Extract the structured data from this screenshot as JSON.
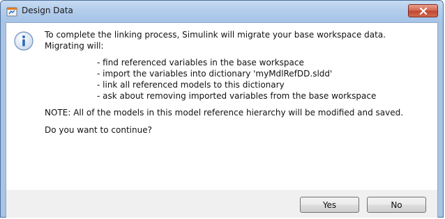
{
  "window": {
    "title": "Design Data",
    "app_icon": "simulink-data-dictionary-icon",
    "close_icon": "close-icon"
  },
  "message": {
    "icon": "info-icon",
    "intro_line1": "To complete the linking process, Simulink will migrate your base workspace data.",
    "intro_line2": "Migrating will:",
    "steps": [
      "- find referenced variables in the base workspace",
      "- import the variables into dictionary 'myMdlRefDD.sldd'",
      "- link all referenced models to this dictionary",
      "- ask about removing imported variables from the base workspace"
    ],
    "note": "NOTE: All of the models in this model reference hierarchy will be modified and saved.",
    "question": "Do you want to continue?"
  },
  "buttons": {
    "yes_label": "Yes",
    "no_label": "No"
  },
  "colors": {
    "titlebar": "#b3cdec",
    "close_button": "#c24530",
    "footer": "#f0f0f0",
    "info_icon": "#2f6db5"
  }
}
